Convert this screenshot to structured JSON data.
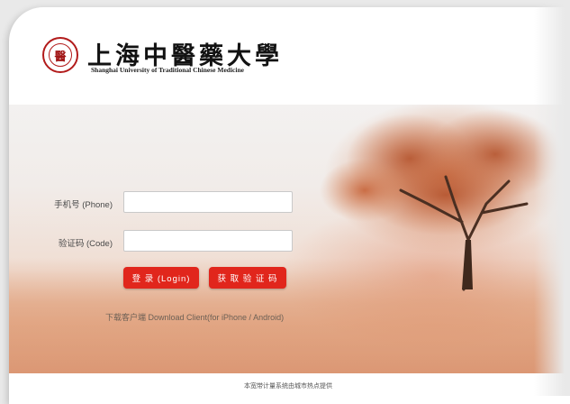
{
  "header": {
    "seal_char": "醫",
    "title_cn": "上海中醫藥大學",
    "title_en": "Shanghai University of Traditional Chinese Medicine"
  },
  "form": {
    "phone_label": "手机号 (Phone)",
    "phone_value": "",
    "code_label": "验证码 (Code)",
    "code_value": "",
    "login_button": "登 录 (Login)",
    "get_code_button": "获 取 验 证 码"
  },
  "download_link": "下载客户端 Download Client(for iPhone / Android)",
  "footer_text": "本宽带计量系统由城市热点提供",
  "colors": {
    "accent": "#e1261c",
    "seal": "#b21b1b"
  }
}
